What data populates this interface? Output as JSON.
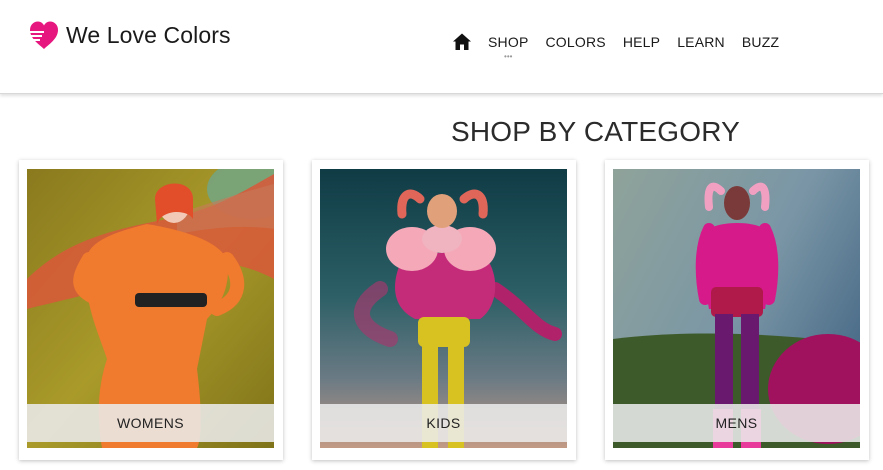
{
  "brand": {
    "name": "We Love Colors",
    "icon": "heart-icon",
    "accent_color": "#e6177e"
  },
  "nav": {
    "home_icon": "home-icon",
    "items": [
      {
        "label": "SHOP",
        "active": true
      },
      {
        "label": "COLORS"
      },
      {
        "label": "HELP"
      },
      {
        "label": "LEARN"
      },
      {
        "label": "BUZZ"
      }
    ],
    "active_marker": "•••"
  },
  "main": {
    "title": "SHOP BY CATEGORY",
    "categories": [
      {
        "label": "WOMENS"
      },
      {
        "label": "KIDS"
      },
      {
        "label": "MENS"
      }
    ]
  }
}
